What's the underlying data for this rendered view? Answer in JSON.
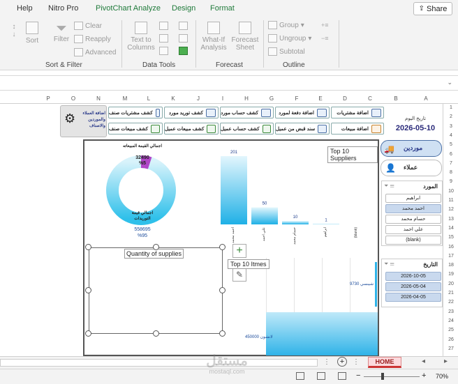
{
  "menubar": {
    "items": [
      "Help",
      "Nitro Pro",
      "PivotChart Analyze",
      "Design",
      "Format"
    ],
    "share_label": "Share"
  },
  "ribbon": {
    "sort_label": "Sort",
    "filter_label": "Filter",
    "clear_label": "Clear",
    "reapply_label": "Reapply",
    "advanced_label": "Advanced",
    "text_to_columns_label": "Text to Columns",
    "whatif_label": "What-If Analysis",
    "forecast_sheet_label": "Forecast Sheet",
    "group_label": "Group",
    "ungroup_label": "Ungroup",
    "subtotal_label": "Subtotal",
    "groups": [
      "Sort & Filter",
      "Data Tools",
      "Forecast",
      "Outline"
    ]
  },
  "columns": [
    "P",
    "O",
    "N",
    "M",
    "L",
    "K",
    "J",
    "I",
    "H",
    "G",
    "F",
    "E",
    "D",
    "C",
    "B",
    "A"
  ],
  "rows": [
    "1",
    "2",
    "3",
    "4",
    "5",
    "6",
    "7",
    "8",
    "9",
    "10",
    "11",
    "12",
    "13",
    "14",
    "15",
    "16",
    "17",
    "18",
    "19",
    "20",
    "21",
    "22",
    "23",
    "24",
    "25",
    "26",
    "27"
  ],
  "header": {
    "today_label": "تاريخ اليوم",
    "today_date": "2026-05-10"
  },
  "nav_buttons": {
    "add_purchases": "اضافة مشتريات",
    "supplier_payment": "اضافة دفعة لمورد",
    "supplier_account": "كشف حساب مورد",
    "supplier_supply": "كشف توريد مورد",
    "purchases_statement": "كشف مشتريات صنف",
    "add_sales": "اضافة مبيعات",
    "customer_receipt": "سند قبض من عميل",
    "customer_account": "كشف حساب عميل",
    "customer_sales": "كشف مبيعات عميل",
    "item_sales": "كشف مبيعات صنف",
    "settings_label": "اضافة العملاء والموردين والاصناف"
  },
  "side_tabs": {
    "suppliers": "موردين",
    "customers": "عملاء"
  },
  "donut": {
    "top_label": "اجمالي القيمة المبيعاته",
    "top_value": "32490",
    "top_percent": "%5",
    "bottom_label": "اجمالي قيمة التوريدات",
    "bottom_value": "558695",
    "bottom_percent": "%95",
    "sales_share": 5,
    "supply_share": 95
  },
  "chart_data": {
    "type": "bar",
    "title": "Top 10 Suppliers",
    "categories": [
      "احمد محمد",
      "علي احمد",
      "حسام محمد",
      "ابراهيم",
      "(blank)"
    ],
    "values": [
      201,
      50,
      10,
      1,
      0
    ]
  },
  "chart_labels": {
    "quantity_title": "Quantity of supplies",
    "top_items_title": "Top 10 Itmes",
    "item_label": "شيبسي",
    "item_value": "9730",
    "item2_label": "لانشون",
    "item2_value": "450000"
  },
  "slicer_supplier": {
    "title": "المورد",
    "items": [
      "ابراهيم",
      "احمد محمد",
      "حسام محمد",
      "علي احمد",
      "(blank)"
    ],
    "selected": [
      false,
      true,
      false,
      false,
      false
    ]
  },
  "slicer_date": {
    "title": "التاريخ",
    "items": [
      "2026-10-05",
      "2026-05-04",
      "2026-04-05"
    ]
  },
  "tabs": {
    "active": "HOME"
  },
  "status": {
    "zoom": "70%"
  },
  "watermark": {
    "brand": "مستقل",
    "url": "mostaql.com"
  }
}
